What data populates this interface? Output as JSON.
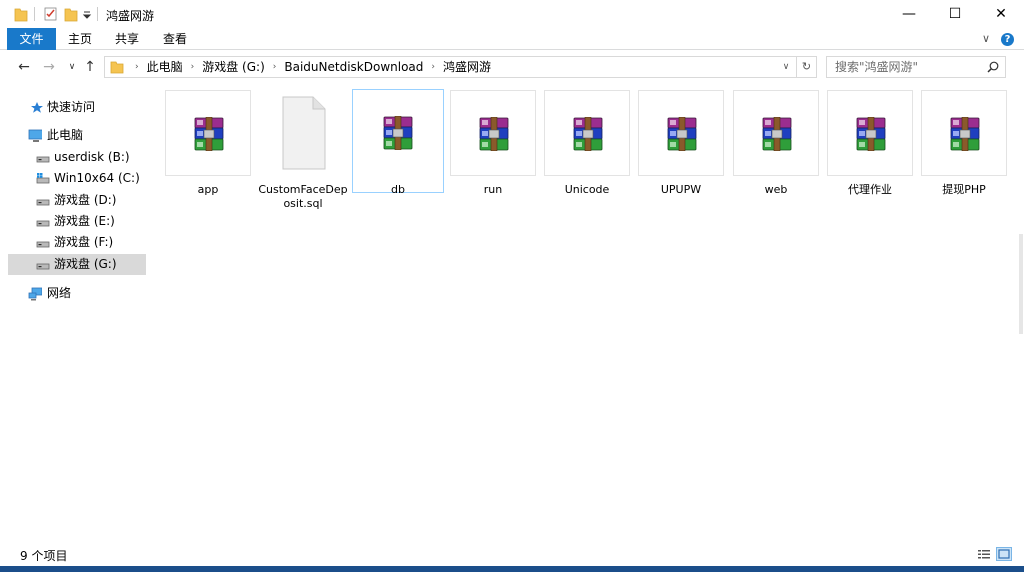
{
  "window": {
    "title": "鸿盛网游",
    "controls": {
      "minimize": "—",
      "maximize": "☐",
      "close": "✕"
    }
  },
  "ribbon": {
    "tabs": [
      {
        "label": "文件",
        "active": true
      },
      {
        "label": "主页"
      },
      {
        "label": "共享"
      },
      {
        "label": "查看"
      }
    ],
    "expand": "∨",
    "help": "?"
  },
  "nav": {
    "back": "←",
    "forward": "→",
    "recent": "∨",
    "up": "↑",
    "breadcrumbs": [
      "此电脑",
      "游戏盘 (G:)",
      "BaiduNetdiskDownload",
      "鸿盛网游"
    ],
    "separator": "›",
    "dropdown": "∨",
    "refresh": "↻",
    "search_placeholder": "搜索\"鸿盛网游\""
  },
  "sidebar": {
    "items": [
      {
        "label": "快速访问",
        "icon": "star-icon"
      },
      {
        "label": "此电脑",
        "icon": "computer-icon"
      },
      {
        "label": "userdisk (B:)",
        "icon": "drive-icon"
      },
      {
        "label": "Win10x64 (C:)",
        "icon": "windows-drive-icon"
      },
      {
        "label": "游戏盘 (D:)",
        "icon": "drive-icon"
      },
      {
        "label": "游戏盘 (E:)",
        "icon": "drive-icon"
      },
      {
        "label": "游戏盘 (F:)",
        "icon": "drive-icon"
      },
      {
        "label": "游戏盘 (G:)",
        "icon": "drive-icon",
        "selected": true
      },
      {
        "label": "网络",
        "icon": "network-icon"
      }
    ]
  },
  "files": [
    {
      "name": "app",
      "type": "archive"
    },
    {
      "name": "CustomFaceDeposit.sql",
      "type": "document"
    },
    {
      "name": "db",
      "type": "archive",
      "selected": true
    },
    {
      "name": "run",
      "type": "archive"
    },
    {
      "name": "Unicode",
      "type": "archive"
    },
    {
      "name": "UPUPW",
      "type": "archive"
    },
    {
      "name": "web",
      "type": "archive"
    },
    {
      "name": "代理作业",
      "type": "archive"
    },
    {
      "name": "提现PHP",
      "type": "archive"
    }
  ],
  "status": {
    "item_count": "9 个项目"
  },
  "colors": {
    "accent": "#1979ca",
    "selection": "#d9d9d9",
    "tile_border": "#e3e3e3",
    "tile_selected_border": "#99d1ff"
  }
}
